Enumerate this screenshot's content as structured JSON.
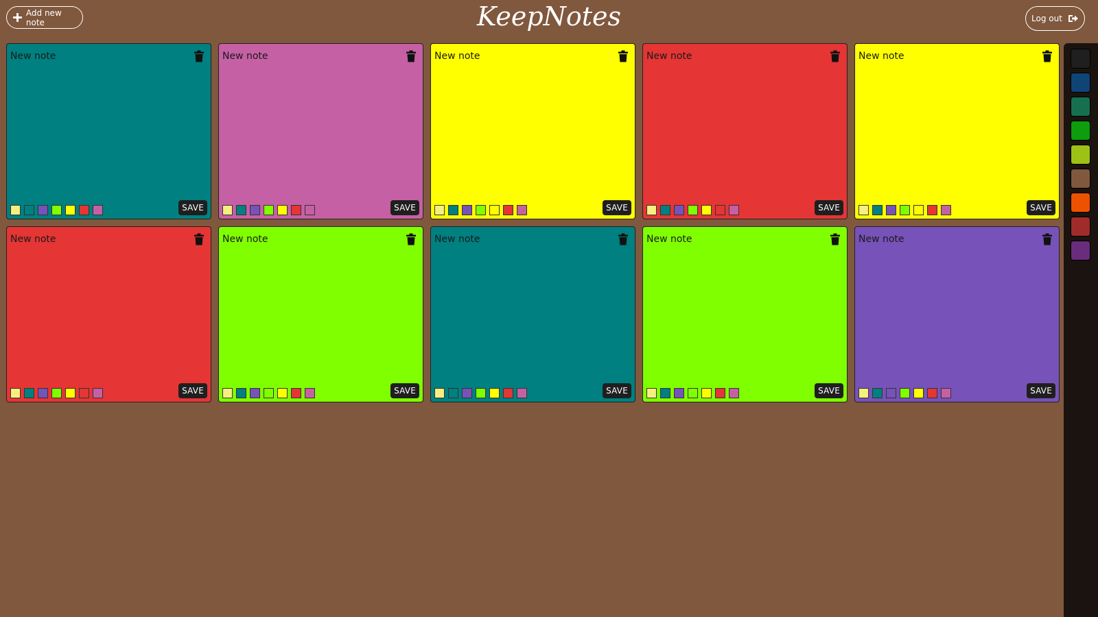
{
  "header": {
    "add_label": "Add new note",
    "logo": "KeepNotes",
    "logout_label": "Log out"
  },
  "swatch_colors": [
    "#f6ef7f",
    "#008080",
    "#7752b8",
    "#80ff00",
    "#ffff00",
    "#e53535",
    "#c660a4"
  ],
  "notes": [
    {
      "title": "New note",
      "color": "#008080",
      "save_label": "SAVE"
    },
    {
      "title": "New note",
      "color": "#c660a4",
      "save_label": "SAVE"
    },
    {
      "title": "New note",
      "color": "#ffff00",
      "save_label": "SAVE"
    },
    {
      "title": "New note",
      "color": "#e53535",
      "save_label": "SAVE"
    },
    {
      "title": "New note",
      "color": "#ffff00",
      "save_label": "SAVE"
    },
    {
      "title": "New note",
      "color": "#e53535",
      "save_label": "SAVE"
    },
    {
      "title": "New note",
      "color": "#80ff00",
      "save_label": "SAVE"
    },
    {
      "title": "New note",
      "color": "#008080",
      "save_label": "SAVE"
    },
    {
      "title": "New note",
      "color": "#80ff00",
      "save_label": "SAVE"
    },
    {
      "title": "New note",
      "color": "#7752b8",
      "save_label": "SAVE"
    }
  ],
  "theme_palette": [
    "#1f1f1f",
    "#0f4477",
    "#16704f",
    "#0d9d0d",
    "#9dc114",
    "#80583e",
    "#ec5200",
    "#9f2b2b",
    "#6a2c7c"
  ],
  "colors": {
    "background": "#80583e",
    "panel": "#1a130f"
  }
}
